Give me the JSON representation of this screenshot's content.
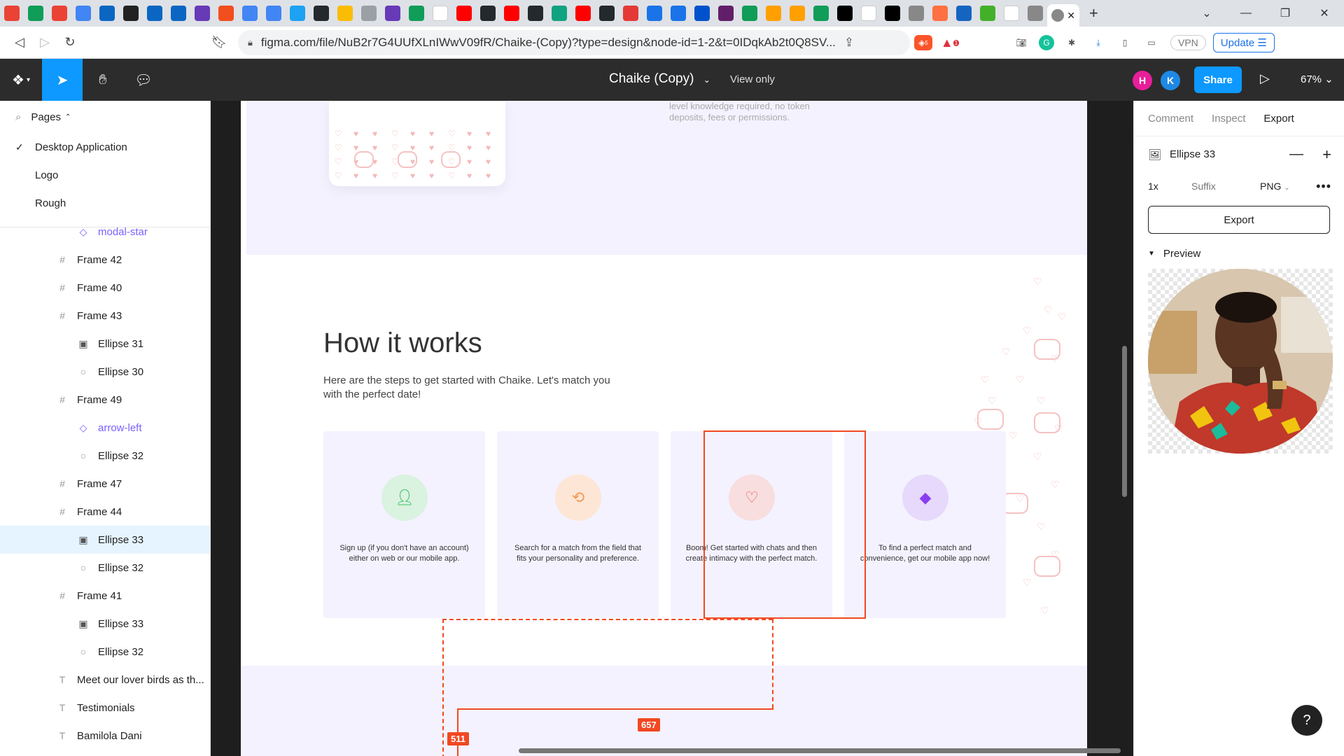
{
  "browser": {
    "tab_favicons": [
      "gmail",
      "sheets",
      "gmail",
      "calendar",
      "linkedin",
      "g",
      "linkedin",
      "linkedin",
      "forms",
      "figma",
      "docs",
      "docs",
      "twitter",
      "github",
      "drive",
      "audio",
      "forms",
      "sheets",
      "wi",
      "youtube",
      "github",
      "youtube",
      "github",
      "chatgpt",
      "youtube",
      "github",
      "record",
      "bookmark",
      "bookmark",
      "atlassian",
      "slack",
      "sheets",
      "firebase",
      "firebase",
      "sheets",
      "seven",
      "google",
      "vercel",
      "chrome",
      "bolt",
      "bot",
      "selenium",
      "google",
      "chrome"
    ],
    "url": "figma.com/file/NuB2r7G4UUfXLnIWwV09fR/Chaike-(Copy)?type=design&node-id=1-2&t=0IDqkAb2t0Q8SV...",
    "vpn_label": "VPN",
    "update_label": "Update",
    "brave_badge": "5",
    "alert_badge": "1"
  },
  "figma": {
    "file_title": "Chaike (Copy)",
    "view_only": "View only",
    "avatars": [
      {
        "letter": "H",
        "color": "#e91e9a"
      },
      {
        "letter": "K",
        "color": "#1e88e5"
      }
    ],
    "share_label": "Share",
    "zoom": "67%"
  },
  "left_panel": {
    "pages_label": "Pages",
    "pages": [
      {
        "label": "Desktop Application",
        "current": true
      },
      {
        "label": "Logo",
        "current": false
      },
      {
        "label": "Rough",
        "current": false
      }
    ],
    "layers": [
      {
        "label": "modal-star",
        "type": "component",
        "indent": 1
      },
      {
        "label": "Frame 42",
        "type": "frame",
        "indent": 0
      },
      {
        "label": "Frame 40",
        "type": "frame",
        "indent": 0
      },
      {
        "label": "Frame 43",
        "type": "frame",
        "indent": 0
      },
      {
        "label": "Ellipse 31",
        "type": "image",
        "indent": 1
      },
      {
        "label": "Ellipse 30",
        "type": "ellipse",
        "indent": 1
      },
      {
        "label": "Frame 49",
        "type": "frame",
        "indent": 0
      },
      {
        "label": "arrow-left",
        "type": "component",
        "indent": 1
      },
      {
        "label": "Ellipse 32",
        "type": "ellipse",
        "indent": 1
      },
      {
        "label": "Frame 47",
        "type": "frame",
        "indent": 0
      },
      {
        "label": "Frame 44",
        "type": "frame",
        "indent": 0
      },
      {
        "label": "Ellipse 33",
        "type": "image",
        "indent": 1,
        "selected": true
      },
      {
        "label": "Ellipse 32",
        "type": "ellipse",
        "indent": 1
      },
      {
        "label": "Frame 41",
        "type": "frame",
        "indent": 0
      },
      {
        "label": "Ellipse 33",
        "type": "image",
        "indent": 1
      },
      {
        "label": "Ellipse 32",
        "type": "ellipse",
        "indent": 1
      },
      {
        "label": "Meet our lover birds as th...",
        "type": "text",
        "indent": 0
      },
      {
        "label": "Testimonials",
        "type": "text",
        "indent": 0
      },
      {
        "label": "Bamilola Dani",
        "type": "text",
        "indent": 0
      }
    ]
  },
  "canvas": {
    "hero_text": "level knowledge required, no token deposits, fees or permissions.",
    "section_title": "How it works",
    "section_desc": "Here are the steps to get started with Chaike. Let's match you with the perfect date!",
    "steps": [
      {
        "text": "Sign up (if you don't have an account) either on web or our mobile app.",
        "icon": "user-check",
        "bg": "#daf2e0",
        "fg": "#2fbf5a"
      },
      {
        "text": "Search for a match from the field that fits your personality and preference.",
        "icon": "search",
        "bg": "#fde6d6",
        "fg": "#f39a52"
      },
      {
        "text": "Boom! Get started with chats and then create intimacy with the perfect match.",
        "icon": "chat-heart",
        "bg": "#f8dede",
        "fg": "#e35d5d"
      },
      {
        "text": "To find a perfect match and convenience, get our mobile app now!",
        "icon": "cube",
        "bg": "#e6d9fb",
        "fg": "#8a3ff0"
      }
    ],
    "measure_labels": [
      "657",
      "511"
    ],
    "selection_color": "#f24822"
  },
  "right_panel": {
    "tabs": [
      {
        "label": "Comment",
        "active": false
      },
      {
        "label": "Inspect",
        "active": false
      },
      {
        "label": "Export",
        "active": true
      }
    ],
    "node_name": "Ellipse 33",
    "export": {
      "scale": "1x",
      "suffix_placeholder": "Suffix",
      "format": "PNG"
    },
    "export_button": "Export",
    "preview_label": "Preview"
  },
  "help_label": "?"
}
